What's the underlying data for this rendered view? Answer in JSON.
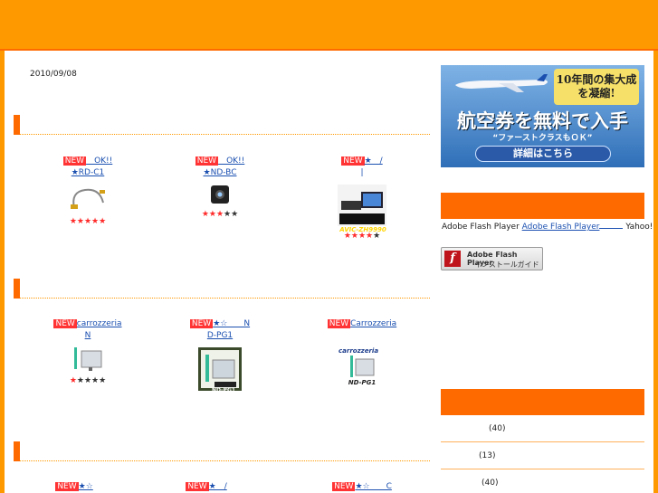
{
  "date": "2010/09/08",
  "sections": [
    {
      "link": "",
      "products": [
        {
          "new": "NEW",
          "title1": "　OK!!",
          "title2": "★RD-C1",
          "stars_on": 5,
          "stars_off": 0,
          "thumb": "cable-icon"
        },
        {
          "new": "NEW",
          "title1": "　OK!!",
          "title2": "★ND-BC",
          "stars_on": 3,
          "stars_off": 2,
          "thumb": "camera-icon"
        },
        {
          "new": "NEW",
          "title1": "★　/",
          "title2": "|",
          "stars_on": 5,
          "stars_off": 0,
          "thumb": "device-icon",
          "thumb_text": "AVIC-ZH9990"
        }
      ],
      "more": ""
    },
    {
      "link": "",
      "products": [
        {
          "new": "NEW",
          "title1": "carrozzeria",
          "title2": "N",
          "stars_on": 1,
          "stars_off": 4,
          "thumb": "antenna-icon"
        },
        {
          "new": "NEW",
          "title1": "★☆　　N",
          "title2": "D-PG1",
          "stars_on": 0,
          "stars_off": 0,
          "thumb": "ndpg1-icon",
          "thumb_text": "ND-PG1"
        },
        {
          "new": "NEW",
          "title1": "Carrozzeria",
          "title2": "",
          "stars_on": 0,
          "stars_off": 0,
          "thumb": "carrozzeria-icon",
          "thumb_brand": "carrozzeria",
          "thumb_text": "ND-PG1"
        }
      ],
      "more": ""
    },
    {
      "link": "",
      "products": [
        {
          "new": "NEW",
          "title1": "★☆",
          "title2": ""
        },
        {
          "new": "NEW",
          "title1": "★　/",
          "title2": ""
        },
        {
          "new": "NEW",
          "title1": "★☆　　C",
          "title2": ""
        }
      ]
    }
  ],
  "ad": {
    "badge": "10年間の集大成を凝縮!",
    "main": "航空券を無料で入手",
    "sub": "“ファーストクラスもＯＫ”",
    "button": "詳細はこちら"
  },
  "flash": {
    "text_before": "Adobe Flash Player",
    "link": "Adobe Flash Player",
    "text_after": "Yahoo!",
    "btn_line1": "Adobe Flash Player",
    "btn_line2": "インストールガイド",
    "logo": "f"
  },
  "categories": [
    {
      "count": "(40)"
    },
    {
      "count": "(13)"
    },
    {
      "count": "(40)"
    }
  ],
  "stars": {
    "on": "★",
    "off": "★"
  },
  "colors": {
    "header": "#ff9900",
    "accent": "#ff6a00",
    "new_badge": "#ff3333",
    "link": "#1a4fb0"
  }
}
